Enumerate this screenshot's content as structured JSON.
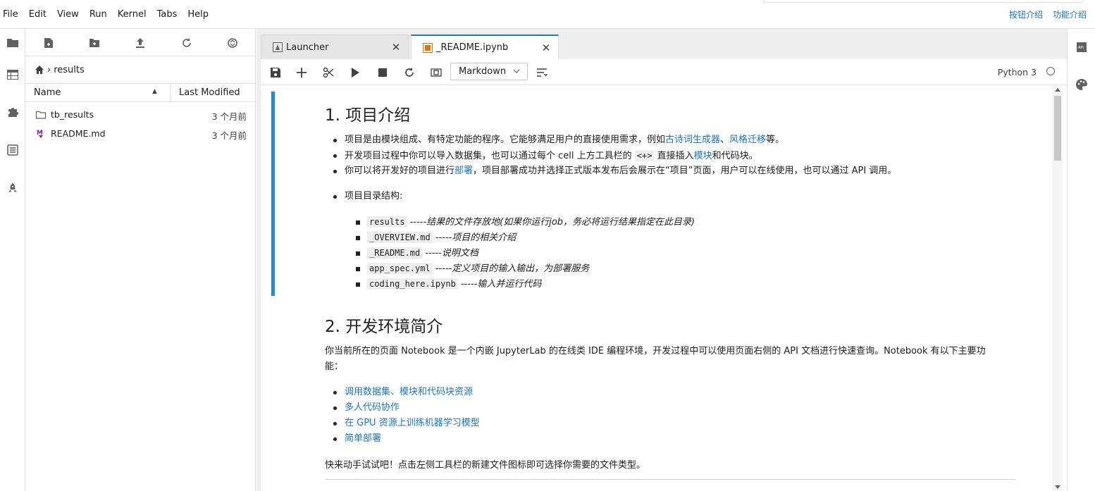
{
  "menu": {
    "items": [
      "File",
      "Edit",
      "View",
      "Run",
      "Kernel",
      "Tabs",
      "Help"
    ]
  },
  "top_links": {
    "buttons_intro": "按钮介绍",
    "features_intro": "功能介绍"
  },
  "left_sidebar": {
    "icons": [
      "folder-icon",
      "table-icon",
      "puzzle-icon",
      "list-icon",
      "rocket-icon"
    ]
  },
  "file_browser": {
    "breadcrumb": "results",
    "columns": {
      "name": "Name",
      "modified": "Last Modified"
    },
    "files": [
      {
        "name": "tb_results",
        "modified": "3 个月前",
        "icon": "folder-icon"
      },
      {
        "name": "README.md",
        "modified": "3 个月前",
        "icon": "markdown-icon"
      }
    ]
  },
  "tabs": [
    {
      "label": "Launcher",
      "icon": "launcher-icon",
      "active": false
    },
    {
      "label": "_README.ipynb",
      "icon": "notebook-icon",
      "active": true
    }
  ],
  "notebook_toolbar": {
    "cell_type": "Markdown",
    "kernel": "Python 3"
  },
  "content": {
    "h1": "1. 项目介绍",
    "bullets1": {
      "b1_pre": "项目是由模块组成、有特定功能的程序。它能够满足用户的直接使用需求，例如",
      "b1_link1": "古诗词生成器",
      "b1_sep": "、",
      "b1_link2": "风格迁移",
      "b1_post": "等。",
      "b2_pre": "开发项目过程中你可以导入数据集，也可以通过每个 cell 上方工具栏的 ",
      "b2_code": "<+>",
      "b2_mid": " 直接插入",
      "b2_link": "模块",
      "b2_post": "和代码块。",
      "b3_pre": "你可以将开发好的项目进行",
      "b3_link": "部署",
      "b3_post": "，项目部署成功并选择正式版本发布后会展示在“项目”页面，用户可以在线使用，也可以通过 API 调用。"
    },
    "structure_label": "项目目录结构:",
    "structure": [
      {
        "code": "results",
        "desc": "结果的文件存放地(如果你运行job，务必将运行结果指定在此目录)"
      },
      {
        "code": "_OVERVIEW.md",
        "desc": "项目的相关介绍"
      },
      {
        "code": "_README.md",
        "desc": "说明文档"
      },
      {
        "code": "app_spec.yml",
        "desc": "定义项目的输入输出，为部署服务"
      },
      {
        "code": "coding_here.ipynb",
        "desc": "输入并运行代码"
      }
    ],
    "structure_sep": " -----",
    "h2": "2. 开发环境简介",
    "para1_line1": "你当前所在的页面 Notebook 是一个内嵌 JupyterLab 的在线类 IDE 编程环境，开发过程中可以使用页面右侧的 API 文档进行快速查询。Notebook 有以下主要功",
    "para1_line2": "能：",
    "links2": [
      "调用数据集、模块和代码块资源",
      "多人代码协作",
      "在 GPU 资源上训练机器学习模型",
      "简单部署"
    ],
    "para2": "快来动手试试吧！点击左侧工具栏的新建文件图标即可选择你需要的文件类型。"
  },
  "right_sidebar": {
    "icons": [
      "api-doc-icon",
      "palette-icon"
    ]
  },
  "colors": {
    "accent": "#1976d2",
    "cell_bar": "#1e88e5",
    "markdown_icon": "#7b1fa2",
    "notebook_icon": "#ef6c00"
  }
}
